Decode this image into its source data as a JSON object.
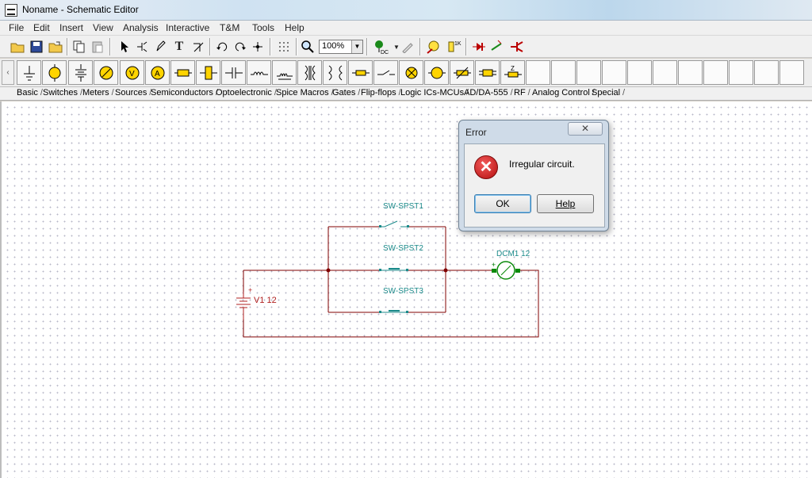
{
  "window": {
    "title": "Noname - Schematic Editor"
  },
  "menu": [
    "File",
    "Edit",
    "Insert",
    "View",
    "Analysis",
    "Interactive",
    "T&M",
    "Tools",
    "Help"
  ],
  "toolbar": {
    "zoom": "100%"
  },
  "tabs": [
    "Basic",
    "Switches",
    "Meters",
    "Sources",
    "Semiconductors",
    "Optoelectronic",
    "Spice Macros",
    "Gates",
    "Flip-flops",
    "Logic ICs-MCUs",
    "AD/DA-555",
    "RF",
    "Analog Control",
    "Special"
  ],
  "schematic": {
    "switch1": "SW-SPST1",
    "switch2": "SW-SPST2",
    "switch3": "SW-SPST3",
    "motor": "DCM1 12",
    "source": "V1 12",
    "plus1": "+",
    "plus2": "+",
    "colors": {
      "wire": "#800000",
      "component": "#1b8a8a",
      "motor": "#0a8a0a",
      "source": "#b02020"
    }
  },
  "dialog": {
    "title": "Error",
    "close": "✕",
    "message": "Irregular circuit.",
    "ok": "OK",
    "help": "Help"
  }
}
